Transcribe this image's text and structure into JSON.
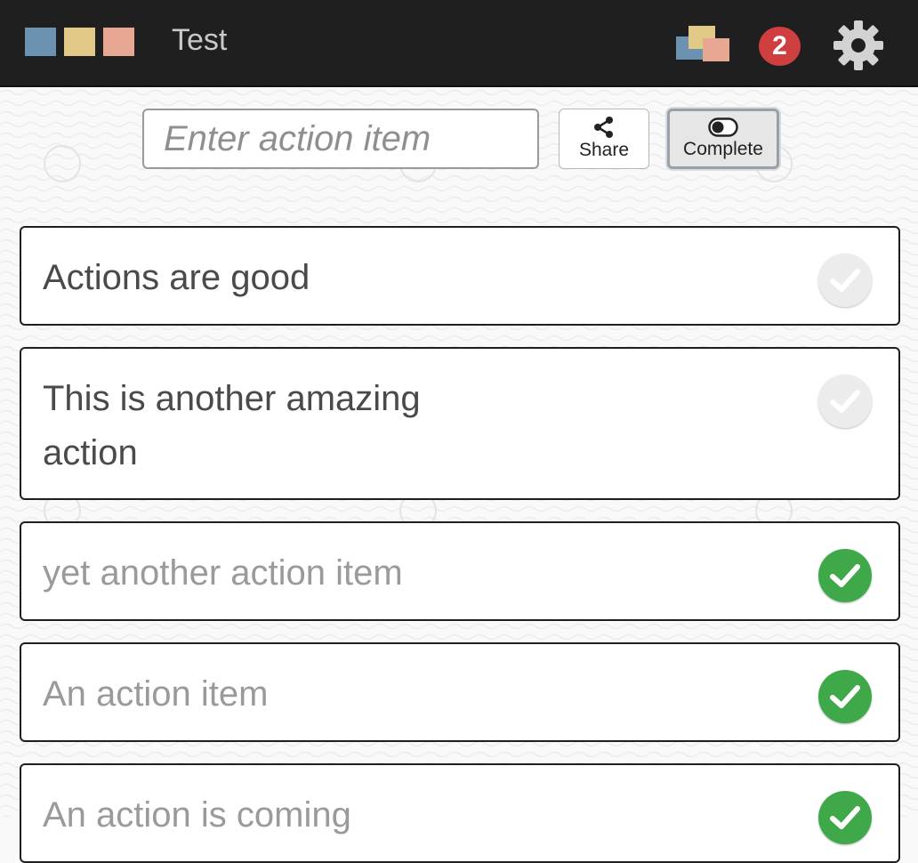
{
  "app": {
    "title": "Test",
    "notification_count": "2",
    "logo_colors": [
      "#6b93b1",
      "#e3c987",
      "#e7a792"
    ]
  },
  "toolbar": {
    "input_placeholder": "Enter action item",
    "input_value": "",
    "share_label": "Share",
    "complete_label": "Complete"
  },
  "items": [
    {
      "text": "Actions are good",
      "completed": false
    },
    {
      "text": "This is another amazing action",
      "completed": false
    },
    {
      "text": "yet another action item",
      "completed": true
    },
    {
      "text": "An action item",
      "completed": true
    },
    {
      "text": "An action is coming",
      "completed": true
    }
  ],
  "colors": {
    "topbar": "#1f1f1f",
    "badge": "#d03f3f",
    "check_on": "#3fa94a",
    "check_off": "#ececec"
  },
  "icons": [
    "boards-icon",
    "gear-icon",
    "share-icon",
    "toggle-icon",
    "check-icon"
  ]
}
